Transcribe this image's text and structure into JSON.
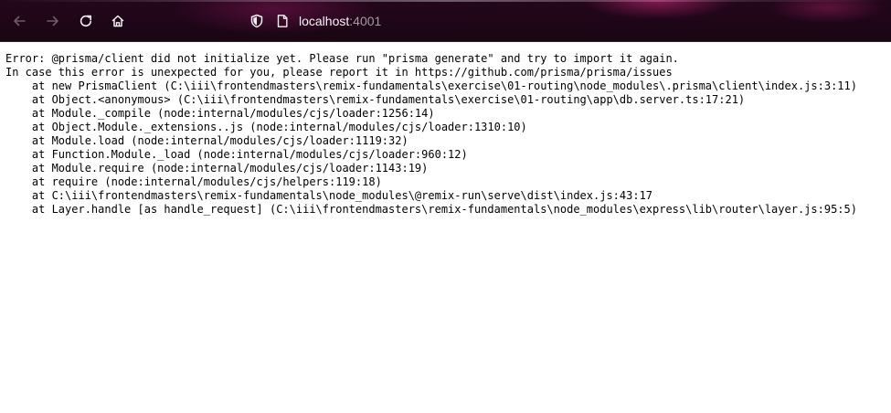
{
  "browser": {
    "url_host": "localhost",
    "url_port": ":4001",
    "icons": {
      "back": "arrow-left-icon",
      "forward": "arrow-right-icon",
      "reload": "reload-icon",
      "home": "home-icon",
      "tracking": "shield-icon",
      "page": "page-icon"
    },
    "colors": {
      "toolbar": "#1a0614",
      "url_text": "#f0f0f4"
    }
  },
  "error": {
    "lines": [
      "Error: @prisma/client did not initialize yet. Please run \"prisma generate\" and try to import it again.",
      "In case this error is unexpected for you, please report it in https://github.com/prisma/prisma/issues",
      "    at new PrismaClient (C:\\iii\\frontendmasters\\remix-fundamentals\\exercise\\01-routing\\node_modules\\.prisma\\client\\index.js:3:11)",
      "    at Object.<anonymous> (C:\\iii\\frontendmasters\\remix-fundamentals\\exercise\\01-routing\\app\\db.server.ts:17:21)",
      "    at Module._compile (node:internal/modules/cjs/loader:1256:14)",
      "    at Object.Module._extensions..js (node:internal/modules/cjs/loader:1310:10)",
      "    at Module.load (node:internal/modules/cjs/loader:1119:32)",
      "    at Function.Module._load (node:internal/modules/cjs/loader:960:12)",
      "    at Module.require (node:internal/modules/cjs/loader:1143:19)",
      "    at require (node:internal/modules/cjs/helpers:119:18)",
      "    at C:\\iii\\frontendmasters\\remix-fundamentals\\node_modules\\@remix-run\\serve\\dist\\index.js:43:17",
      "    at Layer.handle [as handle_request] (C:\\iii\\frontendmasters\\remix-fundamentals\\node_modules\\express\\lib\\router\\layer.js:95:5)"
    ]
  }
}
